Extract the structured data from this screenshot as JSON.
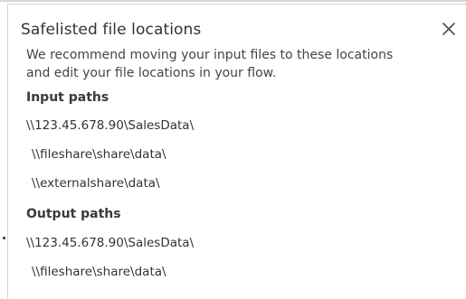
{
  "dialog": {
    "title": "Safelisted file locations",
    "close_icon": "close-icon",
    "description_line1": "We recommend moving your input files to these locations",
    "description_line2": "and edit your file locations in your flow.",
    "input": {
      "label": "Input paths",
      "paths": [
        "\\\\123.45.678.90\\SalesData\\",
        "\\\\fileshare\\share\\data\\",
        "\\\\externalshare\\data\\"
      ]
    },
    "output": {
      "label": "Output paths",
      "paths": [
        "\\\\123.45.678.90\\SalesData\\",
        "\\\\fileshare\\share\\data\\"
      ]
    }
  }
}
